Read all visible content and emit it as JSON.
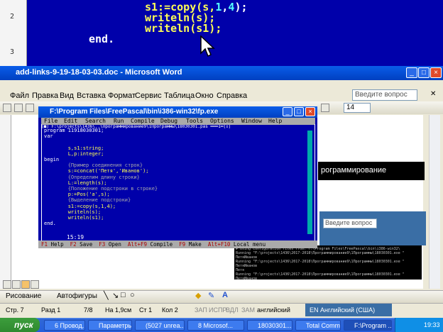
{
  "top_code": {
    "line1_a": "s1:=copy(s,",
    "line1_n1": "1",
    "line1_c": ",",
    "line1_n2": "4",
    "line1_e": ");",
    "line2": "writeln(s);",
    "line3": "writeln(s1);",
    "line4": "end.",
    "ruler_marks": [
      "2",
      "3"
    ]
  },
  "word": {
    "title": "add-links-9-19-18-03-03.doc - Microsoft Word",
    "menu": [
      "Файл",
      "Правка",
      "Вид",
      "Вставка",
      "Формат",
      "Сервис",
      "Таблица",
      "Окно",
      "Справка"
    ],
    "ask_placeholder": "Введите вопрос",
    "font_size": "14",
    "doc_black_text": "рограммирование",
    "inner_input": "Введите вопрос",
    "draw_label": "Рисование",
    "autoshapes_label": "Автофигуры",
    "status": {
      "page": "Стр. 7",
      "section": "Разд 1",
      "pages": "7/8",
      "at": "На 1,9см",
      "line": "Ст 1",
      "col": "Кол 2",
      "rec": "ЗАП",
      "trk": "ИСПР",
      "ext": "ВДЛ",
      "ovr": "ЗАМ",
      "lang": "английский"
    },
    "langbar": "Английский (США)"
  },
  "fp": {
    "title": "F:\\Program Files\\FreePascal\\bin\\i386-win32\\fp.exe",
    "menu": [
      "File",
      "Edit",
      "Search",
      "Run",
      "Compile",
      "Debug",
      "Tools",
      "Options",
      "Window",
      "Help"
    ],
    "filebar": "[■] F:\\projects\\1436\\..\\Программирование9\\1Программы\\18030301.pas ═══1═[↕]",
    "code": [
      "program 11918030301;",
      "var",
      "",
      "        s,s1:string;",
      "        L,p:integer;",
      "begin",
      "        {Пример соединения строк}",
      "        s:=concat('Петя','Иванов');",
      "        {Определим длину строки}",
      "        L:=length(s);",
      "        {Положение подстроки в строке}",
      "        p:=Pos('a',s);",
      "        {Выделение подстроки}",
      "        s1:=copy(s,1,4);",
      "        writeln(s);",
      "        writeln(s1);",
      "end."
    ],
    "cursor_pos": "15:19",
    "fkeys": [
      {
        "k": "F1",
        "t": " Help  "
      },
      {
        "k": "F2",
        "t": " Save  "
      },
      {
        "k": "F3",
        "t": " Open  "
      },
      {
        "k": "Alt+F9",
        "t": " Compile  "
      },
      {
        "k": "F9",
        "t": " Make  "
      },
      {
        "k": "Alt+F10",
        "t": " Local menu"
      }
    ]
  },
  "console2": "# Using configuration files from: F:\\Program Files\\FreePascal\\bin\\i386-win32\\\nRunning \"F:\\projects\\1436\\2017-2018\\Программирование9\\1Программы\\18030301.exe \"\nПетяИванов\nRunning \"F:\\projects\\1436\\2017-2018\\Программирование9\\1Программы\\18030301.exe \"\nПетяИванов\nПетя\nRunning \"F:\\projects\\1436\\2017-2018\\Программирование9\\1Программы\\18030301.exe \"\nПетяИванов\nПетя",
  "taskbar": {
    "start": "пуск",
    "tasks": [
      "6 Провод...",
      "Параметры...",
      "(5027 unrea...",
      "8 Microsof...",
      "18030301...",
      "Total Comm...",
      "F:\\Program ..."
    ],
    "clock": "19:33"
  }
}
